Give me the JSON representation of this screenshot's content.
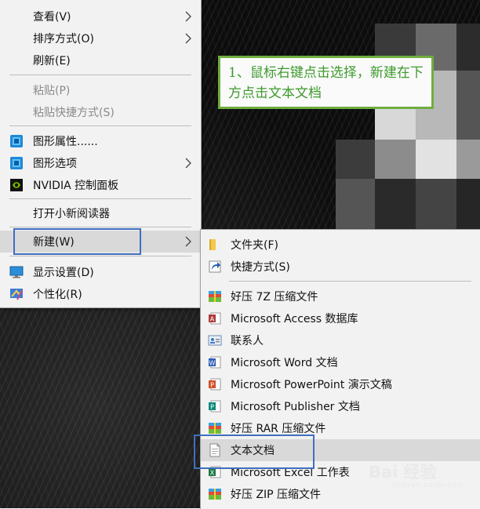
{
  "main_menu": {
    "items": [
      {
        "label": "查看(V)",
        "submenu": true,
        "disabled": false
      },
      {
        "label": "排序方式(O)",
        "submenu": true,
        "disabled": false
      },
      {
        "label": "刷新(E)",
        "submenu": false,
        "disabled": false
      },
      {
        "label": "粘贴(P)",
        "submenu": false,
        "disabled": true
      },
      {
        "label": "粘贴快捷方式(S)",
        "submenu": false,
        "disabled": true
      },
      {
        "label": "图形属性......",
        "icon": "intel-graphics-icon"
      },
      {
        "label": "图形选项",
        "icon": "intel-graphics-icon",
        "submenu": true
      },
      {
        "label": "NVIDIA 控制面板",
        "icon": "nvidia-icon"
      },
      {
        "label": "打开小新阅读器"
      },
      {
        "label": "新建(W)",
        "submenu": true,
        "highlighted": true
      },
      {
        "label": "显示设置(D)",
        "icon": "display-icon"
      },
      {
        "label": "个性化(R)",
        "icon": "personalize-icon"
      }
    ]
  },
  "new_submenu": {
    "items": [
      {
        "label": "文件夹(F)",
        "icon": "folder-icon"
      },
      {
        "label": "快捷方式(S)",
        "icon": "shortcut-icon"
      },
      {
        "label": "好压 7Z 压缩文件",
        "icon": "archive-icon"
      },
      {
        "label": "Microsoft Access 数据库",
        "icon": "access-icon"
      },
      {
        "label": "联系人",
        "icon": "contact-icon"
      },
      {
        "label": "Microsoft Word 文档",
        "icon": "word-icon"
      },
      {
        "label": "Microsoft PowerPoint 演示文稿",
        "icon": "powerpoint-icon"
      },
      {
        "label": "Microsoft Publisher 文档",
        "icon": "publisher-icon"
      },
      {
        "label": "好压 RAR 压缩文件",
        "icon": "archive-icon"
      },
      {
        "label": "文本文档",
        "icon": "text-document-icon",
        "highlighted": true
      },
      {
        "label": "Microsoft Excel 工作表",
        "icon": "excel-icon"
      },
      {
        "label": "好压 ZIP 压缩文件",
        "icon": "archive-icon"
      }
    ]
  },
  "callout": {
    "text": "1、鼠标右键点击选择，新建在下方点击文本文档"
  },
  "watermark": {
    "text": "Bai 经验",
    "sub": "jingyan.baidu.com"
  },
  "colors": {
    "highlight_border": "#3f6fc0",
    "callout_border": "#6fae3f",
    "callout_text": "#3e9a2c",
    "menu_bg": "#f2f2f2",
    "hover_bg": "#d9d9d9"
  }
}
